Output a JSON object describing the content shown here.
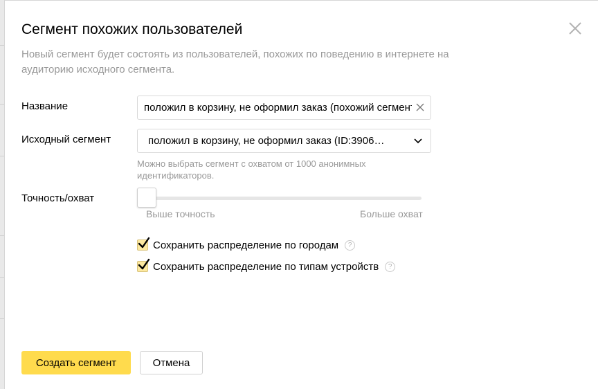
{
  "dialog": {
    "title": "Сегмент похожих пользователей",
    "subtitle": "Новый сегмент будет состоять из пользователей, похожих по поведению в интернете на аудиторию исходного сегмента."
  },
  "form": {
    "name_label": "Название",
    "name_value": "положил в корзину, не оформил заказ (похожий сегмент)",
    "source_label": "Исходный сегмент",
    "source_value": "положил в корзину, не оформил заказ (ID:3906…",
    "source_hint": "Можно выбрать сегмент с охватом от 1000 анонимных идентификаторов.",
    "accuracy_label": "Точность/охват",
    "slider_min_label": "Выше точность",
    "slider_max_label": "Больше охват",
    "slider_level": 0
  },
  "options": [
    {
      "label": "Сохранить распределение по городам",
      "checked": true
    },
    {
      "label": "Сохранить распределение по типам устройств",
      "checked": true
    }
  ],
  "buttons": {
    "create": "Создать сегмент",
    "cancel": "Отмена"
  },
  "icons": {
    "close": "close-icon",
    "clear": "clear-icon",
    "chevron": "chevron-down-icon",
    "help": "?"
  },
  "colors": {
    "accent": "#ffdb4d",
    "checkbox_fill": "#fde9a0",
    "muted_text": "#999999"
  }
}
